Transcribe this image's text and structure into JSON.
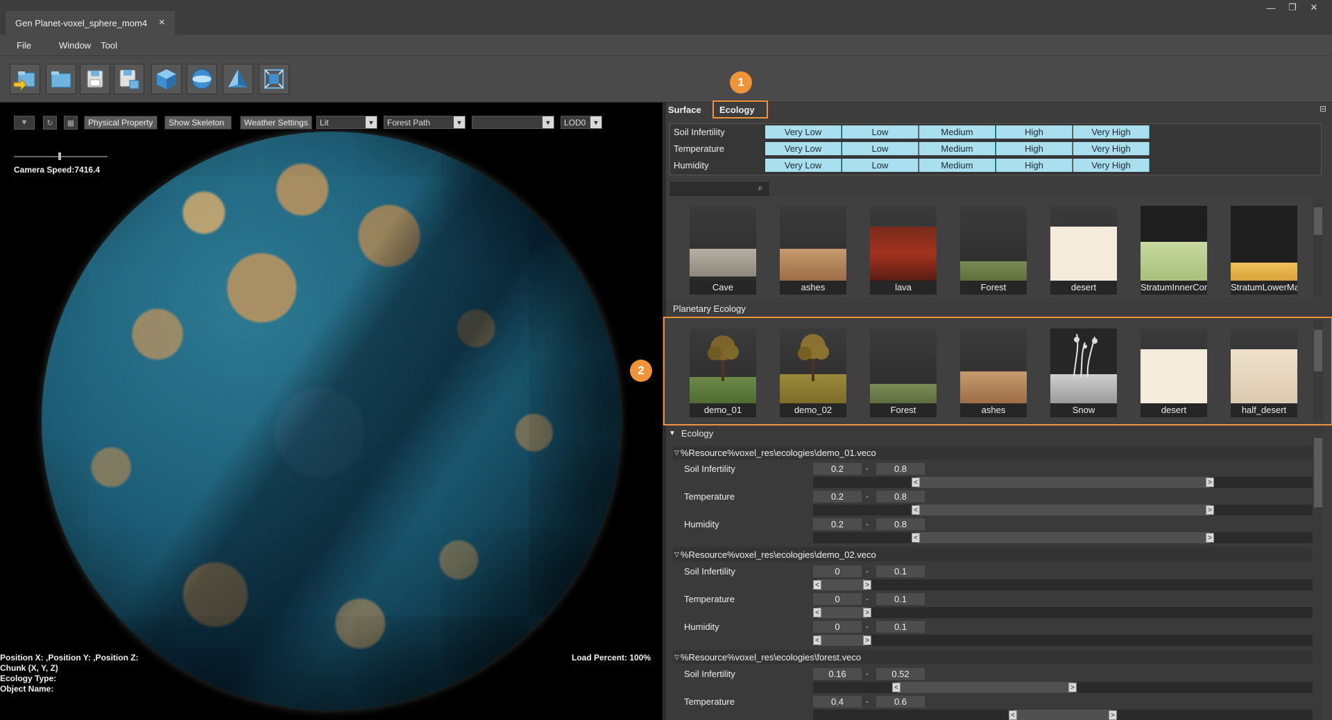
{
  "window": {
    "tab_title": "Gen Planet-voxel_sphere_mom4",
    "tab_close_icon": "×",
    "controls": [
      "—",
      "❐",
      "✕"
    ]
  },
  "menu": [
    "File",
    "Window",
    "Tool"
  ],
  "toolbar": {
    "buttons": [
      "import-icon",
      "open-folder-icon",
      "save-icon",
      "save-as-icon",
      "cube-icon",
      "sphere-icon",
      "pyramid-icon",
      "fit-view-icon"
    ]
  },
  "viewport": {
    "physical_property": "Physical Property",
    "show_skeleton": "Show Skeleton",
    "weather_settings": "Weather Settings",
    "render_mode": "Lit",
    "path_mode": "Forest Path",
    "empty_combo": "",
    "lod": "LOD0",
    "camera_speed": "Camera Speed:7416.4",
    "position": "Position X: ,Position Y: ,Position Z:",
    "chunk": "Chunk (X, Y, Z)",
    "ecology_type": "Ecology Type:",
    "object_name": "Object Name:",
    "load_percent": "Load Percent: 100%"
  },
  "panel": {
    "tabs": [
      "Surface",
      "Ecology"
    ],
    "active_tab": "Ecology",
    "badge1": "1",
    "badge2": "2",
    "pin_icon": "⊟",
    "properties": [
      {
        "label": "Soil Infertility",
        "levels": [
          "Very Low",
          "Low",
          "Medium",
          "High",
          "Very High"
        ]
      },
      {
        "label": "Temperature",
        "levels": [
          "Very Low",
          "Low",
          "Medium",
          "High",
          "Very High"
        ]
      },
      {
        "label": "Humidity",
        "levels": [
          "Very Low",
          "Low",
          "Medium",
          "High",
          "Very High"
        ]
      }
    ],
    "search_placeholder": "",
    "surface_assets": [
      "Cave",
      "ashes",
      "lava",
      "Forest",
      "desert",
      "StratumInnerCor",
      "StratumLowerMan"
    ],
    "planetary_ecology_label": "Planetary Ecology",
    "ecology_assets": [
      "demo_01",
      "demo_02",
      "Forest",
      "ashes",
      "Snow",
      "desert",
      "half_desert"
    ],
    "ecology_section": "Ecology",
    "ecologies": [
      {
        "path": "%Resource%voxel_res\\ecologies\\demo_01.veco",
        "rows": [
          {
            "label": "Soil Infertility",
            "min": "0.2",
            "max": "0.8"
          },
          {
            "label": "Temperature",
            "min": "0.2",
            "max": "0.8"
          },
          {
            "label": "Humidity",
            "min": "0.2",
            "max": "0.8"
          }
        ]
      },
      {
        "path": "%Resource%voxel_res\\ecologies\\demo_02.veco",
        "rows": [
          {
            "label": "Soil Infertility",
            "min": "0",
            "max": "0.1"
          },
          {
            "label": "Temperature",
            "min": "0",
            "max": "0.1"
          },
          {
            "label": "Humidity",
            "min": "0",
            "max": "0.1"
          }
        ]
      },
      {
        "path": "%Resource%voxel_res\\ecologies\\forest.veco",
        "rows": [
          {
            "label": "Soil Infertility",
            "min": "0.16",
            "max": "0.52"
          },
          {
            "label": "Temperature",
            "min": "0.4",
            "max": "0.6"
          }
        ]
      }
    ]
  }
}
